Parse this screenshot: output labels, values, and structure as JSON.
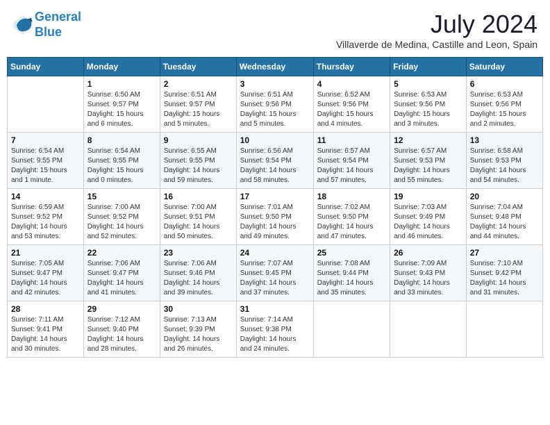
{
  "header": {
    "logo_line1": "General",
    "logo_line2": "Blue",
    "month_title": "July 2024",
    "subtitle": "Villaverde de Medina, Castille and Leon, Spain"
  },
  "weekdays": [
    "Sunday",
    "Monday",
    "Tuesday",
    "Wednesday",
    "Thursday",
    "Friday",
    "Saturday"
  ],
  "weeks": [
    [
      {
        "day": "",
        "info": ""
      },
      {
        "day": "1",
        "info": "Sunrise: 6:50 AM\nSunset: 9:57 PM\nDaylight: 15 hours\nand 6 minutes."
      },
      {
        "day": "2",
        "info": "Sunrise: 6:51 AM\nSunset: 9:57 PM\nDaylight: 15 hours\nand 5 minutes."
      },
      {
        "day": "3",
        "info": "Sunrise: 6:51 AM\nSunset: 9:56 PM\nDaylight: 15 hours\nand 5 minutes."
      },
      {
        "day": "4",
        "info": "Sunrise: 6:52 AM\nSunset: 9:56 PM\nDaylight: 15 hours\nand 4 minutes."
      },
      {
        "day": "5",
        "info": "Sunrise: 6:53 AM\nSunset: 9:56 PM\nDaylight: 15 hours\nand 3 minutes."
      },
      {
        "day": "6",
        "info": "Sunrise: 6:53 AM\nSunset: 9:56 PM\nDaylight: 15 hours\nand 2 minutes."
      }
    ],
    [
      {
        "day": "7",
        "info": "Sunrise: 6:54 AM\nSunset: 9:55 PM\nDaylight: 15 hours\nand 1 minute."
      },
      {
        "day": "8",
        "info": "Sunrise: 6:54 AM\nSunset: 9:55 PM\nDaylight: 15 hours\nand 0 minutes."
      },
      {
        "day": "9",
        "info": "Sunrise: 6:55 AM\nSunset: 9:55 PM\nDaylight: 14 hours\nand 59 minutes."
      },
      {
        "day": "10",
        "info": "Sunrise: 6:56 AM\nSunset: 9:54 PM\nDaylight: 14 hours\nand 58 minutes."
      },
      {
        "day": "11",
        "info": "Sunrise: 6:57 AM\nSunset: 9:54 PM\nDaylight: 14 hours\nand 57 minutes."
      },
      {
        "day": "12",
        "info": "Sunrise: 6:57 AM\nSunset: 9:53 PM\nDaylight: 14 hours\nand 55 minutes."
      },
      {
        "day": "13",
        "info": "Sunrise: 6:58 AM\nSunset: 9:53 PM\nDaylight: 14 hours\nand 54 minutes."
      }
    ],
    [
      {
        "day": "14",
        "info": "Sunrise: 6:59 AM\nSunset: 9:52 PM\nDaylight: 14 hours\nand 53 minutes."
      },
      {
        "day": "15",
        "info": "Sunrise: 7:00 AM\nSunset: 9:52 PM\nDaylight: 14 hours\nand 52 minutes."
      },
      {
        "day": "16",
        "info": "Sunrise: 7:00 AM\nSunset: 9:51 PM\nDaylight: 14 hours\nand 50 minutes."
      },
      {
        "day": "17",
        "info": "Sunrise: 7:01 AM\nSunset: 9:50 PM\nDaylight: 14 hours\nand 49 minutes."
      },
      {
        "day": "18",
        "info": "Sunrise: 7:02 AM\nSunset: 9:50 PM\nDaylight: 14 hours\nand 47 minutes."
      },
      {
        "day": "19",
        "info": "Sunrise: 7:03 AM\nSunset: 9:49 PM\nDaylight: 14 hours\nand 46 minutes."
      },
      {
        "day": "20",
        "info": "Sunrise: 7:04 AM\nSunset: 9:48 PM\nDaylight: 14 hours\nand 44 minutes."
      }
    ],
    [
      {
        "day": "21",
        "info": "Sunrise: 7:05 AM\nSunset: 9:47 PM\nDaylight: 14 hours\nand 42 minutes."
      },
      {
        "day": "22",
        "info": "Sunrise: 7:06 AM\nSunset: 9:47 PM\nDaylight: 14 hours\nand 41 minutes."
      },
      {
        "day": "23",
        "info": "Sunrise: 7:06 AM\nSunset: 9:46 PM\nDaylight: 14 hours\nand 39 minutes."
      },
      {
        "day": "24",
        "info": "Sunrise: 7:07 AM\nSunset: 9:45 PM\nDaylight: 14 hours\nand 37 minutes."
      },
      {
        "day": "25",
        "info": "Sunrise: 7:08 AM\nSunset: 9:44 PM\nDaylight: 14 hours\nand 35 minutes."
      },
      {
        "day": "26",
        "info": "Sunrise: 7:09 AM\nSunset: 9:43 PM\nDaylight: 14 hours\nand 33 minutes."
      },
      {
        "day": "27",
        "info": "Sunrise: 7:10 AM\nSunset: 9:42 PM\nDaylight: 14 hours\nand 31 minutes."
      }
    ],
    [
      {
        "day": "28",
        "info": "Sunrise: 7:11 AM\nSunset: 9:41 PM\nDaylight: 14 hours\nand 30 minutes."
      },
      {
        "day": "29",
        "info": "Sunrise: 7:12 AM\nSunset: 9:40 PM\nDaylight: 14 hours\nand 28 minutes."
      },
      {
        "day": "30",
        "info": "Sunrise: 7:13 AM\nSunset: 9:39 PM\nDaylight: 14 hours\nand 26 minutes."
      },
      {
        "day": "31",
        "info": "Sunrise: 7:14 AM\nSunset: 9:38 PM\nDaylight: 14 hours\nand 24 minutes."
      },
      {
        "day": "",
        "info": ""
      },
      {
        "day": "",
        "info": ""
      },
      {
        "day": "",
        "info": ""
      }
    ]
  ]
}
